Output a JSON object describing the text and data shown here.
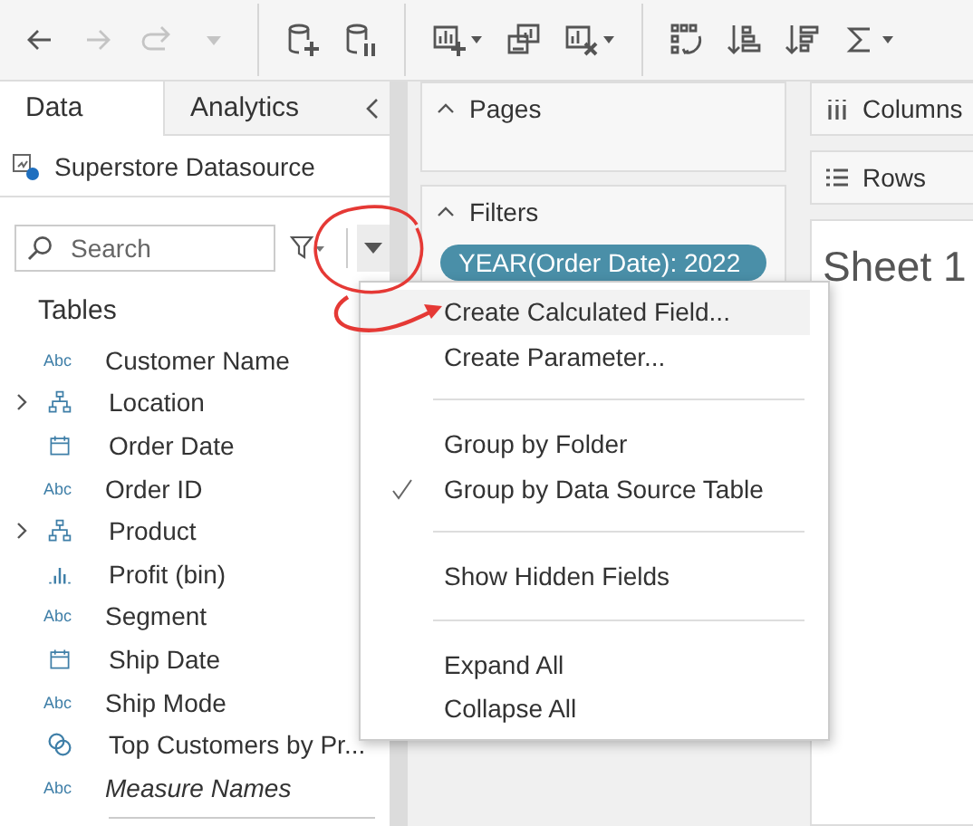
{
  "toolbar": [
    {
      "kind": "back",
      "disabled": false
    },
    {
      "kind": "forward",
      "disabled": true
    },
    {
      "kind": "redo",
      "disabled": true
    },
    {
      "kind": "caret",
      "disabled": true
    },
    {
      "kind": "separator"
    },
    {
      "kind": "new-datasource",
      "disabled": false
    },
    {
      "kind": "pause",
      "disabled": false
    },
    {
      "kind": "separator"
    },
    {
      "kind": "new-sheet",
      "disabled": false
    },
    {
      "kind": "duplicate",
      "disabled": false
    },
    {
      "kind": "clear",
      "disabled": false
    },
    {
      "kind": "separator"
    },
    {
      "kind": "swap",
      "disabled": false
    },
    {
      "kind": "sort-asc",
      "disabled": false
    },
    {
      "kind": "sort-desc",
      "disabled": false
    },
    {
      "kind": "totals",
      "disabled": false
    }
  ],
  "data_pane": {
    "tabs": [
      {
        "label": "Data",
        "selected": true
      },
      {
        "label": "Analytics",
        "selected": false
      }
    ],
    "datasource": "Superstore Datasource",
    "search": {
      "placeholder": "Search"
    },
    "section": "Tables",
    "fields": [
      {
        "name": "Customer Name",
        "kind": "string",
        "icon_text": "Abc"
      },
      {
        "name": "Location",
        "kind": "hierarchy",
        "expanded": false
      },
      {
        "name": "Order Date",
        "kind": "date"
      },
      {
        "name": "Order ID",
        "kind": "string",
        "icon_text": "Abc"
      },
      {
        "name": "Product",
        "kind": "hierarchy",
        "expanded": false
      },
      {
        "name": "Profit (bin)",
        "kind": "bin"
      },
      {
        "name": "Segment",
        "kind": "string",
        "icon_text": "Abc"
      },
      {
        "name": "Ship Date",
        "kind": "date"
      },
      {
        "name": "Ship Mode",
        "kind": "string",
        "icon_text": "Abc"
      },
      {
        "name": "Top Customers by Pr...",
        "kind": "set"
      },
      {
        "name": "Measure Names",
        "kind": "generated",
        "icon_text": "Abc"
      }
    ]
  },
  "pages": {
    "title": "Pages",
    "expanded": true
  },
  "filters": {
    "title": "Filters",
    "expanded": true,
    "pills": [
      "YEAR(Order Date): 2022"
    ]
  },
  "columns": {
    "title": "Columns"
  },
  "rows": {
    "title": "Rows"
  },
  "sheet": {
    "title": "Sheet 1"
  },
  "menu": [
    {
      "kind": "item",
      "label": "Create Calculated Field...",
      "checked": false,
      "selected": true
    },
    {
      "kind": "item",
      "label": "Create Parameter...",
      "checked": false,
      "selected": false
    },
    {
      "kind": "separator"
    },
    {
      "kind": "item",
      "label": "Group by Folder",
      "checked": false,
      "selected": false
    },
    {
      "kind": "item",
      "label": "Group by Data Source Table",
      "checked": true,
      "selected": false
    },
    {
      "kind": "separator"
    },
    {
      "kind": "item",
      "label": "Show Hidden Fields",
      "checked": false,
      "selected": false
    },
    {
      "kind": "separator"
    },
    {
      "kind": "item",
      "label": "Expand All",
      "checked": false,
      "selected": false
    },
    {
      "kind": "item",
      "label": "Collapse All",
      "checked": false,
      "selected": false
    }
  ]
}
